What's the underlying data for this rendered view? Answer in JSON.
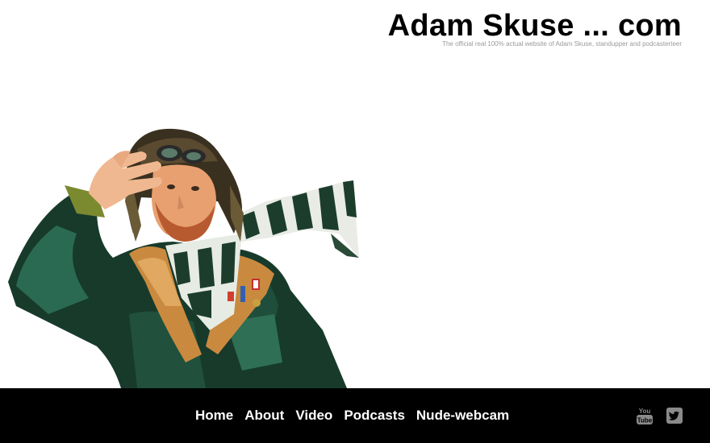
{
  "header": {
    "title": "Adam Skuse ... com",
    "tagline": "The official real 100% actual website of Adam Skuse, standupper and podcasterteer"
  },
  "hero": {
    "image_description_icon": "aviator-portrait-photo"
  },
  "footer": {
    "nav": [
      {
        "label": "Home"
      },
      {
        "label": "About"
      },
      {
        "label": "Video"
      },
      {
        "label": "Podcasts"
      },
      {
        "label": "Nude-webcam"
      }
    ],
    "social": {
      "youtube_text_top": "You",
      "youtube_text_bottom": "Tube",
      "youtube_icon": "youtube-icon",
      "twitter_icon": "twitter-icon"
    },
    "colors": {
      "background": "#000000",
      "link": "#ffffff",
      "icon": "#8a8a8a"
    }
  }
}
